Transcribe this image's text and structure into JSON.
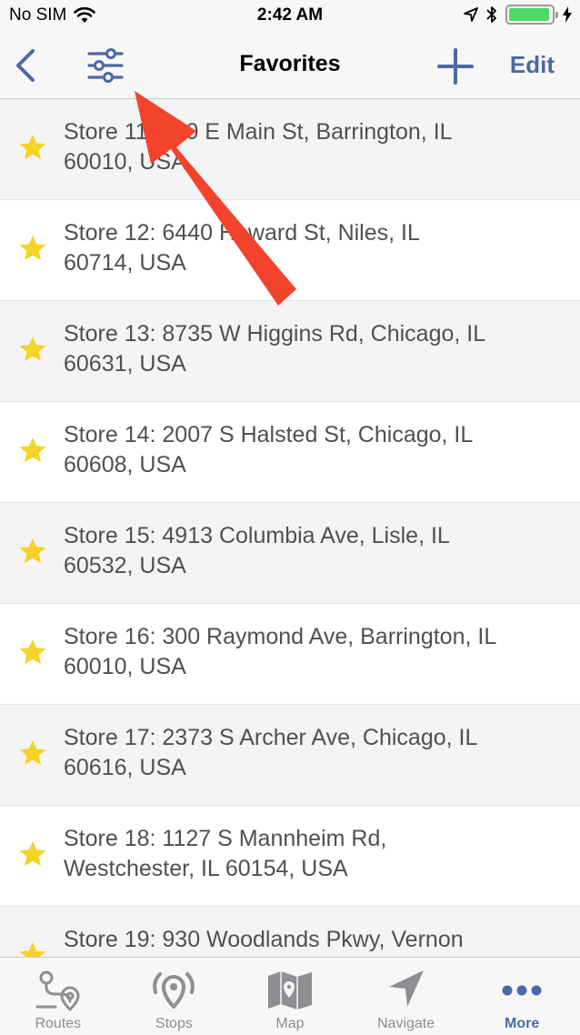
{
  "status_bar": {
    "carrier": "No SIM",
    "time": "2:42 AM",
    "icons": [
      "wifi-icon",
      "location-arrow-icon",
      "bluetooth-icon",
      "battery-icon",
      "charging-icon"
    ],
    "battery_color": "#4cd964",
    "battery_level": 0.95
  },
  "nav": {
    "title": "Favorites",
    "edit_label": "Edit",
    "accent_color": "#4a6aa5",
    "icons": [
      "back-chevron-icon",
      "filter-sliders-icon",
      "plus-icon"
    ]
  },
  "favorites": [
    {
      "line1": "Store 11: 600 E Main St, Barrington, IL",
      "line2": "60010, USA"
    },
    {
      "line1": "Store 12: 6440 Howard St, Niles, IL",
      "line2": "60714, USA"
    },
    {
      "line1": "Store 13: 8735 W Higgins Rd, Chicago, IL",
      "line2": "60631, USA"
    },
    {
      "line1": "Store 14: 2007 S Halsted St, Chicago, IL",
      "line2": "60608, USA"
    },
    {
      "line1": "Store 15: 4913 Columbia Ave, Lisle, IL",
      "line2": "60532, USA"
    },
    {
      "line1": "Store 16: 300 Raymond Ave, Barrington, IL",
      "line2": "60010, USA"
    },
    {
      "line1": "Store 17: 2373 S Archer Ave, Chicago, IL",
      "line2": "60616, USA"
    },
    {
      "line1": "Store 18: 1127 S Mannheim Rd,",
      "line2": "Westchester, IL 60154, USA"
    },
    {
      "line1": "Store 19: 930 Woodlands Pkwy, Vernon",
      "line2": ""
    }
  ],
  "star_color": "#f5d327",
  "tabs": [
    {
      "label": "Routes",
      "icon": "routes-icon",
      "active": false
    },
    {
      "label": "Stops",
      "icon": "stops-icon",
      "active": false
    },
    {
      "label": "Map",
      "icon": "map-icon",
      "active": false
    },
    {
      "label": "Navigate",
      "icon": "navigate-icon",
      "active": false
    },
    {
      "label": "More",
      "icon": "more-dots-icon",
      "active": true
    }
  ],
  "annotation": {
    "arrow_color": "#f4432c"
  }
}
